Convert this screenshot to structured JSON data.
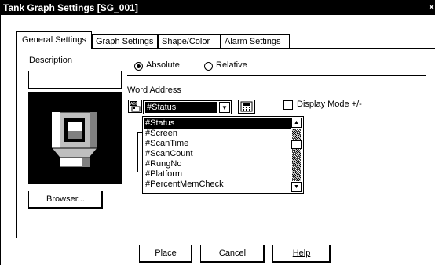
{
  "window": {
    "title": "Tank Graph Settings [SG_001]",
    "close_glyph": "×"
  },
  "tabs": [
    {
      "label": "General Settings"
    },
    {
      "label": "Graph Settings"
    },
    {
      "label": "Shape/Color"
    },
    {
      "label": "Alarm Settings"
    }
  ],
  "general": {
    "description_label": "Description",
    "description_value": "",
    "radio_absolute": "Absolute",
    "radio_relative": "Relative",
    "absolute_selected": true,
    "word_address_label": "Word Address",
    "word_address_value": "#Status",
    "display_mode_label": "Display Mode +/-",
    "display_mode_checked": false,
    "browser_button": "Browser..."
  },
  "dropdown": {
    "options": [
      "#Status",
      "#Screen",
      "#ScanTime",
      "#ScanCount",
      "#RungNo",
      "#Platform",
      "#PercentMemCheck"
    ],
    "selected_index": 0
  },
  "footer": {
    "place_button": "Place",
    "cancel_button": "Cancel",
    "help_button": "Help"
  }
}
